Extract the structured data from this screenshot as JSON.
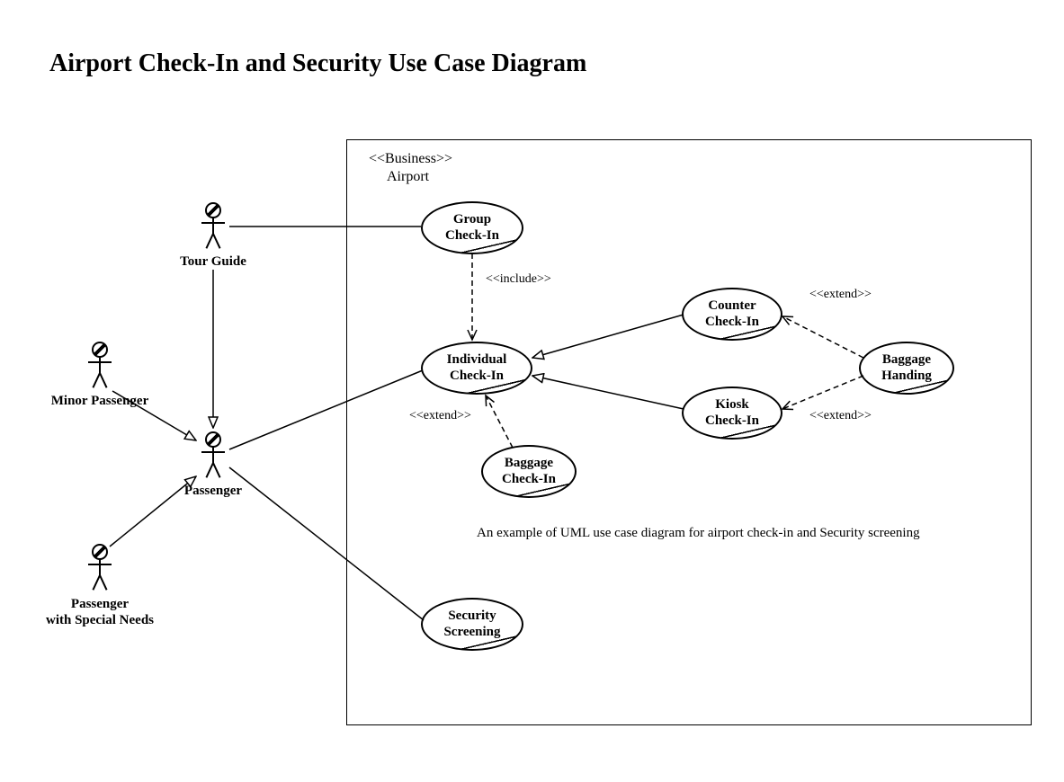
{
  "title": "Airport Check-In and Security Use Case Diagram",
  "boundary": {
    "stereotype": "<<Business>>",
    "name": "Airport"
  },
  "actors": {
    "tour_guide": "Tour Guide",
    "minor_passenger": "Minor Passenger",
    "passenger": "Passenger",
    "passenger_special": "Passenger\nwith Special Needs"
  },
  "usecases": {
    "group_checkin": "Group\nCheck-In",
    "individual_checkin": "Individual\nCheck-In",
    "counter_checkin": "Counter\nCheck-In",
    "kiosk_checkin": "Kiosk\nCheck-In",
    "baggage_handing": "Baggage\nHanding",
    "baggage_checkin": "Baggage\nCheck-In",
    "security_screening": "Security\nScreening"
  },
  "relationships": {
    "include": "<<include>>",
    "extend_1": "<<extend>>",
    "extend_2": "<<extend>>",
    "extend_3": "<<extend>>"
  },
  "caption": "An example of UML use case diagram for airport check-in and Security screening"
}
